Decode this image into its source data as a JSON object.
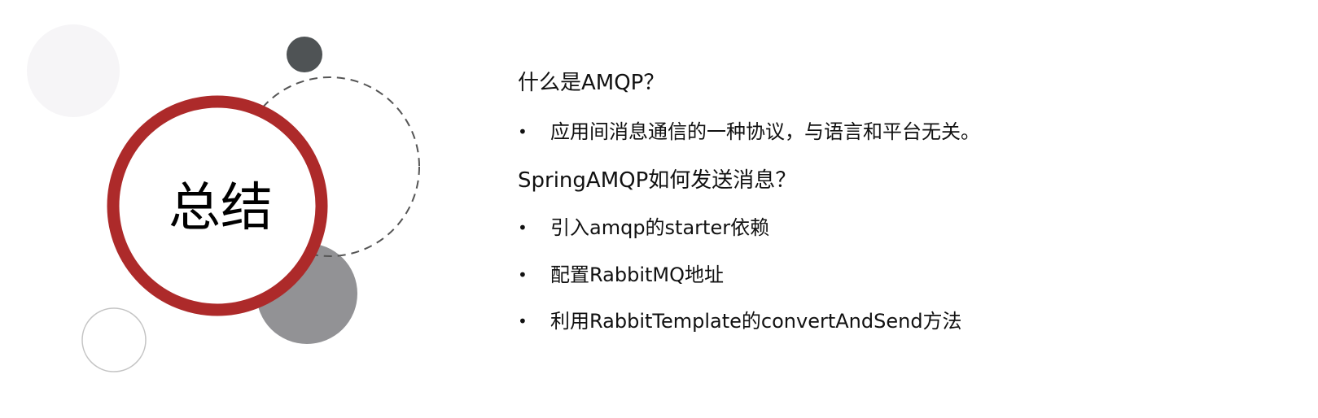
{
  "slide": {
    "title": "总结",
    "sections": [
      {
        "heading": "什么是AMQP？",
        "bullets": [
          "应用间消息通信的一种协议，与语言和平台无关。"
        ]
      },
      {
        "heading": "SpringAMQP如何发送消息？",
        "bullets": [
          "引入amqp的starter依赖",
          "配置RabbitMQ地址",
          "利用RabbitTemplate的convertAndSend方法"
        ]
      }
    ],
    "bullet_char": "•",
    "colors": {
      "accent": "#ad2a2a",
      "dark": "#4f5355",
      "gray": "#929295",
      "light": "#f6f5f7"
    }
  }
}
